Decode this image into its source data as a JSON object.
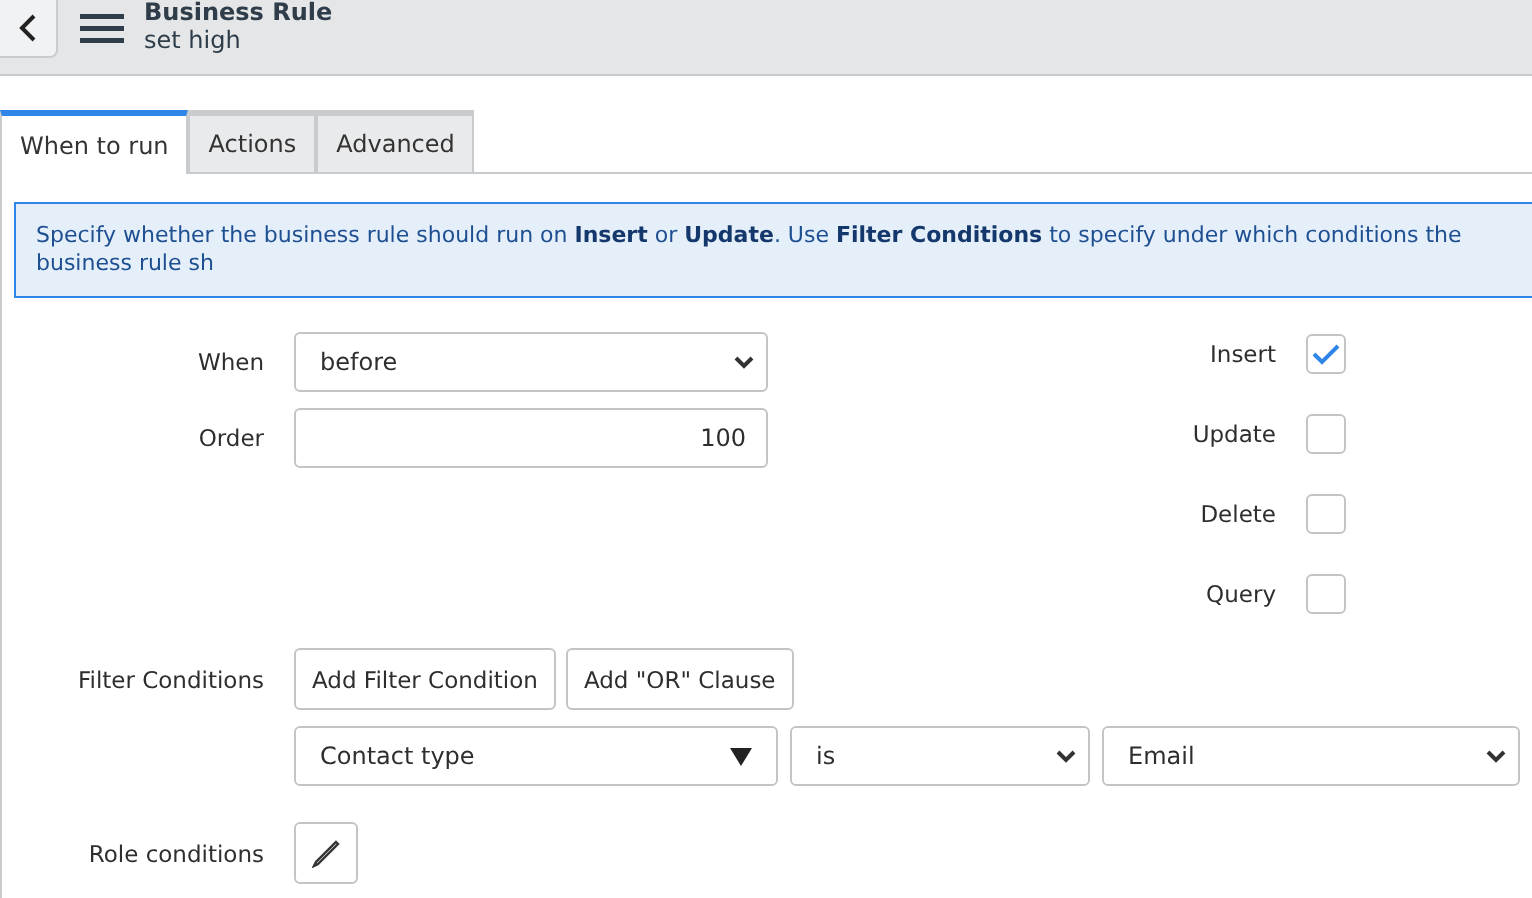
{
  "header": {
    "title": "Business Rule",
    "subtitle": "set high"
  },
  "tabs": [
    {
      "label": "When to run",
      "selected": true
    },
    {
      "label": "Actions",
      "selected": false
    },
    {
      "label": "Advanced",
      "selected": false
    }
  ],
  "info": "Specify whether the business rule should run on **Insert** or **Update**. Use **Filter Conditions** to specify under which conditions the business rule sh",
  "when": {
    "label": "When",
    "value": "before"
  },
  "order": {
    "label": "Order",
    "value": "100"
  },
  "operations": [
    {
      "label": "Insert",
      "checked": true
    },
    {
      "label": "Update",
      "checked": false
    },
    {
      "label": "Delete",
      "checked": false
    },
    {
      "label": "Query",
      "checked": false
    }
  ],
  "filter": {
    "label": "Filter Conditions",
    "buttons": [
      "Add Filter Condition",
      "Add \"OR\" Clause"
    ],
    "field": "Contact type",
    "operator": "is",
    "value": "Email"
  },
  "role": {
    "label": "Role conditions"
  }
}
